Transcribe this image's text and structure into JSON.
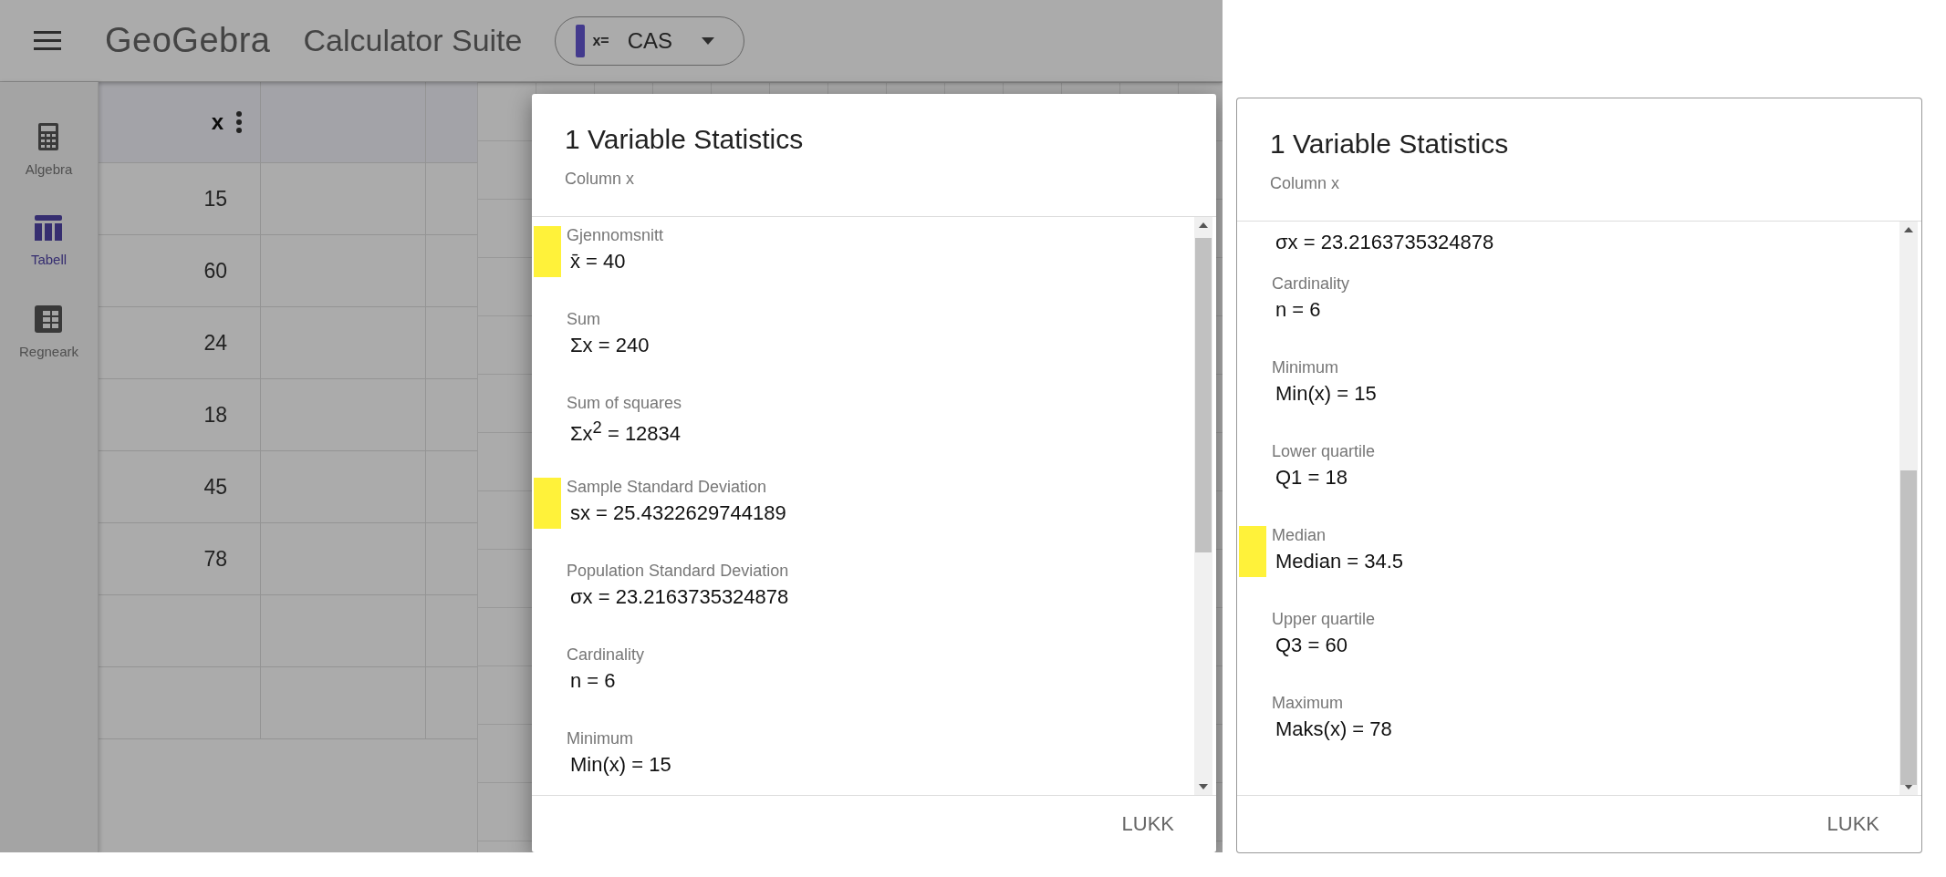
{
  "app_bar": {
    "brand": "GeoGebra",
    "title": "Calculator Suite",
    "mode": {
      "prefix": "x=",
      "label": "CAS"
    }
  },
  "sidebar": {
    "items": [
      {
        "kind": "calculator",
        "label": "Algebra",
        "selected": false
      },
      {
        "kind": "table",
        "label": "Tabell",
        "selected": true
      },
      {
        "kind": "spreadsheet",
        "label": "Regneark",
        "selected": false
      }
    ]
  },
  "table": {
    "columns": [
      "x"
    ],
    "rows": [
      "15",
      "60",
      "24",
      "18",
      "45",
      "78"
    ]
  },
  "dialogs": [
    {
      "title": "1 Variable Statistics",
      "subtitle": "Column x",
      "stats": [
        {
          "label": "Gjennomsnitt",
          "value": "x̄ = 40",
          "highlighted": true
        },
        {
          "label": "Sum",
          "value": "Σx = 240",
          "highlighted": false
        },
        {
          "label": "Sum of squares",
          "value": "Σx$^{2}$ = 12834",
          "highlighted": false
        },
        {
          "label": "Sample Standard Deviation",
          "value": "sx = 25.4322629744189",
          "highlighted": true
        },
        {
          "label": "Population Standard Deviation",
          "value": "σx = 23.2163735324878",
          "highlighted": false
        },
        {
          "label": "Cardinality",
          "value": "n = 6",
          "highlighted": false
        },
        {
          "label": "Minimum",
          "value": "Min(x) = 15",
          "highlighted": false
        }
      ],
      "button": "LUKK"
    },
    {
      "title": "1 Variable Statistics",
      "subtitle": "Column x",
      "stats": [
        {
          "value": "σx = 23.2163735324878",
          "highlighted": false
        },
        {
          "label": "Cardinality",
          "value": "n = 6",
          "highlighted": false
        },
        {
          "label": "Minimum",
          "value": "Min(x) = 15",
          "highlighted": false
        },
        {
          "label": "Lower quartile",
          "value": "Q1 = 18",
          "highlighted": false
        },
        {
          "label": "Median",
          "value": "Median = 34.5",
          "highlighted": true
        },
        {
          "label": "Upper quartile",
          "value": "Q3 = 60",
          "highlighted": false
        },
        {
          "label": "Maximum",
          "value": "Maks(x) = 78",
          "highlighted": false
        }
      ],
      "button": "LUKK"
    }
  ]
}
